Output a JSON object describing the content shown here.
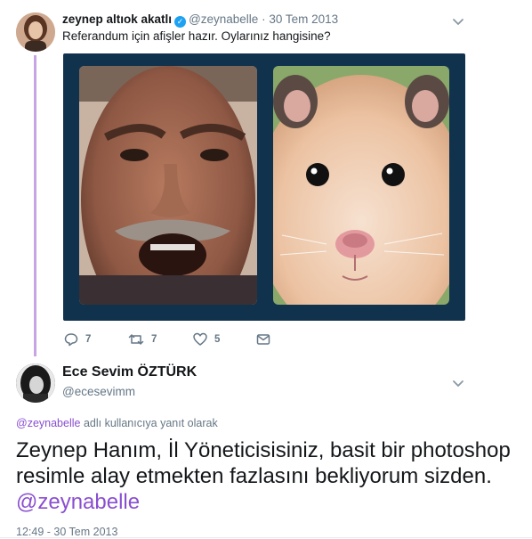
{
  "tweet": {
    "author_name": "zeynep altıok akatlı",
    "author_handle": "@zeynabelle",
    "separator": "·",
    "date": "30 Tem 2013",
    "text": "Referandum için afişler hazır. Oylarınız hangisine?",
    "reply_count": "7",
    "retweet_count": "7",
    "like_count": "5",
    "icons": {
      "reply": "reply-icon",
      "retweet": "retweet-icon",
      "like": "heart-icon",
      "dm": "envelope-icon",
      "more": "chevron-down-icon",
      "verified": "verified-badge-icon"
    },
    "media_background": "#11324d"
  },
  "reply": {
    "author_name": "Ece Sevim ÖZTÜRK",
    "author_handle": "@ecesevimm",
    "reply_to_mention": "@zeynabelle",
    "reply_to_suffix": " adlı kullanıcıya yanıt olarak",
    "body_text": "Zeynep Hanım, İl Yöneticisisiniz, basit bir photoshop resimle alay etmekten fazlasını bekliyorum sizden. ",
    "body_mention": "@zeynabelle",
    "timestamp": "12:49 - 30 Tem 2013"
  },
  "colors": {
    "mention": "#8a4fd0",
    "thread_line": "#c6a4e5",
    "muted_text": "#657786",
    "verified": "#1da1f2"
  }
}
